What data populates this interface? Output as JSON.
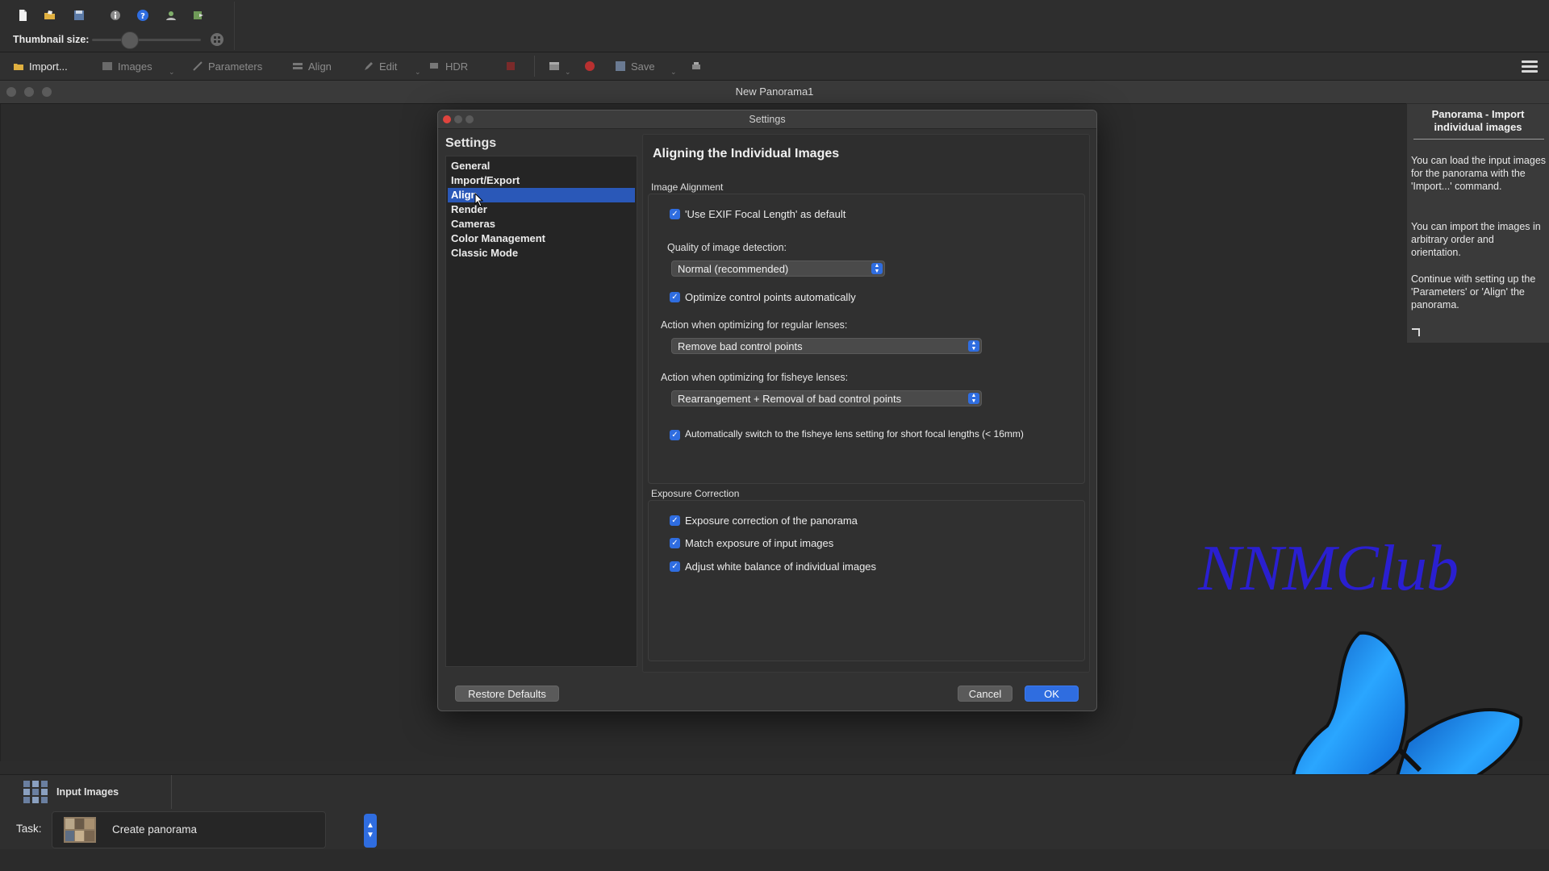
{
  "toolbar": {
    "icons": [
      "new-document-icon",
      "open-folder-icon",
      "save-disk-icon",
      "info-icon",
      "help-icon",
      "user-icon",
      "export-icon"
    ],
    "thumbnail_label": "Thumbnail size:",
    "thumbnail_value": 0.35
  },
  "workflow": {
    "import": "Import...",
    "images": "Images",
    "parameters": "Parameters",
    "align": "Align",
    "edit": "Edit",
    "hdr": "HDR",
    "save": "Save"
  },
  "document": {
    "title": "New Panorama1"
  },
  "dialog": {
    "title": "Settings",
    "heading": "Settings",
    "categories": [
      "General",
      "Import/Export",
      "Align",
      "Render",
      "Cameras",
      "Color Management",
      "Classic Mode"
    ],
    "selected_category": "Align",
    "section_title": "Aligning the Individual Images",
    "image_alignment": {
      "group_label": "Image Alignment",
      "use_exif": "'Use EXIF Focal Length' as default",
      "quality_label": "Quality of image detection:",
      "quality_value": "Normal (recommended)",
      "optimize_cp": "Optimize control points automatically",
      "regular_label": "Action when optimizing for regular lenses:",
      "regular_value": "Remove bad control points",
      "fisheye_label": "Action when optimizing for fisheye lenses:",
      "fisheye_value": "Rearrangement + Removal of bad control points",
      "auto_fisheye": "Automatically switch to the fisheye lens setting for short focal lengths (< 16mm)"
    },
    "exposure": {
      "group_label": "Exposure Correction",
      "exposure_panorama": "Exposure correction of the panorama",
      "match_exposure": "Match exposure of input images",
      "white_balance": "Adjust white balance of individual images"
    },
    "buttons": {
      "restore": "Restore Defaults",
      "cancel": "Cancel",
      "ok": "OK"
    }
  },
  "help": {
    "title": "Panorama - Import individual images",
    "p1": "You can load the input images for the panorama with the 'Import...' command.",
    "p2": "You can import the images in arbitrary order and orientation.",
    "p3": "Continue with setting up the 'Parameters' or 'Align' the panorama."
  },
  "watermark": "NNMClub",
  "bottom": {
    "tab_label": "Input Images",
    "task_label": "Task:",
    "task_value": "Create panorama"
  },
  "colors": {
    "accent": "#2f6de0",
    "selection": "#2a58b8",
    "watermark": "#2a1fd0"
  }
}
